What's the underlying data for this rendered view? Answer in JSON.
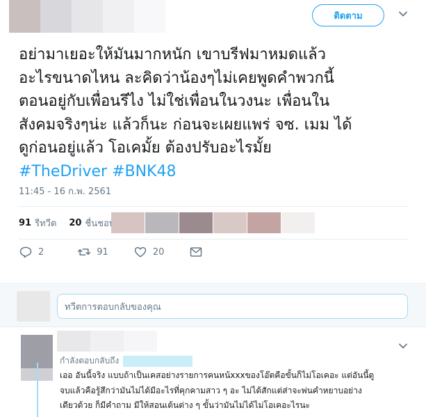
{
  "header": {
    "follow_label": "ติดตาม",
    "author_mosaic": [
      "#c9bfbe",
      "#d8d8dc",
      "#e6e6e8",
      "#f0f0f2",
      "#f8f8fa"
    ]
  },
  "tweet": {
    "text_lines": [
      "อย่ามาเยอะให้มันมากหนัก เขาบรีฟมาหมดแล้ว",
      "อะไรขนาดไหน ละคิดว่าน้องๆไม่เคยพูดคำพวกนี้",
      "ตอนอยู่กับเพื่อนรึไง ไม่ใช่เพื่อนในวงนะ เพื่อนใน",
      "สังคมจริงๆน่ะ แล้วก็นะ ก่อนจะเผยแพร่ จซ. เมม ได้",
      "ดูก่อนอยู่แล้ว โอเคมั้ย ต้องปรับอะไรมั้ย"
    ],
    "hashtags": [
      "#TheDriver",
      "#BNK48"
    ],
    "timestamp": "11:45 - 16 ก.พ. 2561",
    "retweets_count": "91",
    "retweets_label": "รีทวีต",
    "likes_count": "20",
    "likes_label": "ชื่นชอบ",
    "liker_avatars": [
      "#d7c4c2",
      "#b9b7bb",
      "#9b8a8e",
      "#d9c9c6",
      "#c4a4a2",
      "#f2f0ee"
    ],
    "actions": {
      "reply_count": "2",
      "retweet_count": "91",
      "like_count": "20"
    }
  },
  "reply_composer": {
    "placeholder": "ทวีตการตอบกลับของคุณ"
  },
  "reply": {
    "name_mosaic": [
      "#e8e8ea",
      "#f0f0f2",
      "#f6f6f8"
    ],
    "replying_to_label": "กำลังตอบกลับถึง",
    "text_lines": [
      "เออ อันนี้จริง แบบถ้าเป็นเคสอย่างรายการคนหน้xxxของโอ๊ตคือขั้นก็ไม่โอเคอะ แต่อันนี้ดู",
      "จบแล้วคือรู้สึกว่ามันไม่ได้มีอะไรที่คุกคามสาว ๆ อะ ไม่ได้สักแต่ส่าจะพ่นคำหยาบอย่าง",
      "เดียวด้วย ก็มีคำถาม มีให้สอนเต้นต่าง ๆ ขั้นว่ามันไม่ได้ไม่โอเคอะไรนะ"
    ]
  }
}
